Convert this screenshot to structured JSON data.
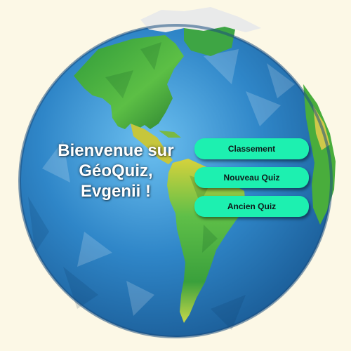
{
  "welcome": {
    "line1": "Bienvenue sur",
    "line2": "GéoQuiz,",
    "line3": "Evgenii !"
  },
  "menu": {
    "leaderboard_label": "Classement",
    "new_quiz_label": "Nouveau Quiz",
    "old_quiz_label": "Ancien Quiz"
  },
  "colors": {
    "background": "#fcf8e6",
    "ocean": "#2b7fc2",
    "ocean_light": "#4aa6e0",
    "land_green": "#3aa63c",
    "land_yellow": "#c9c93a",
    "ice": "#e6e6e6",
    "button": "#1df0b0"
  }
}
